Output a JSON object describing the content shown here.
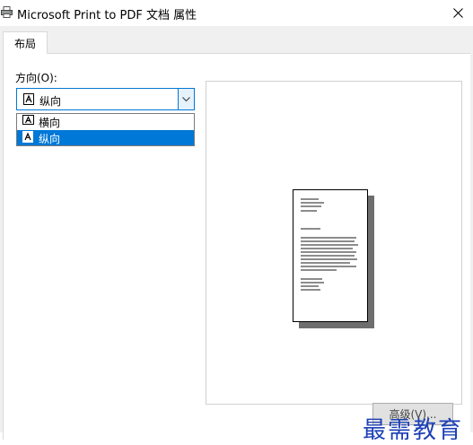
{
  "window": {
    "title": "Microsoft Print to PDF 文档 属性",
    "close_glyph": "✕"
  },
  "tabs": [
    {
      "label": "布局",
      "selected": true
    }
  ],
  "orientation": {
    "label": "方向(O):",
    "selected_value": "纵向",
    "options": [
      "横向",
      "纵向"
    ],
    "highlighted_option": "纵向"
  },
  "preview": {
    "page_orientation": "portrait"
  },
  "buttons": {
    "advanced_label": "高级(V)..."
  },
  "watermark": {
    "text": "最需教育"
  },
  "colors": {
    "accent": "#0078d7",
    "watermark": "#1b3fb5"
  }
}
